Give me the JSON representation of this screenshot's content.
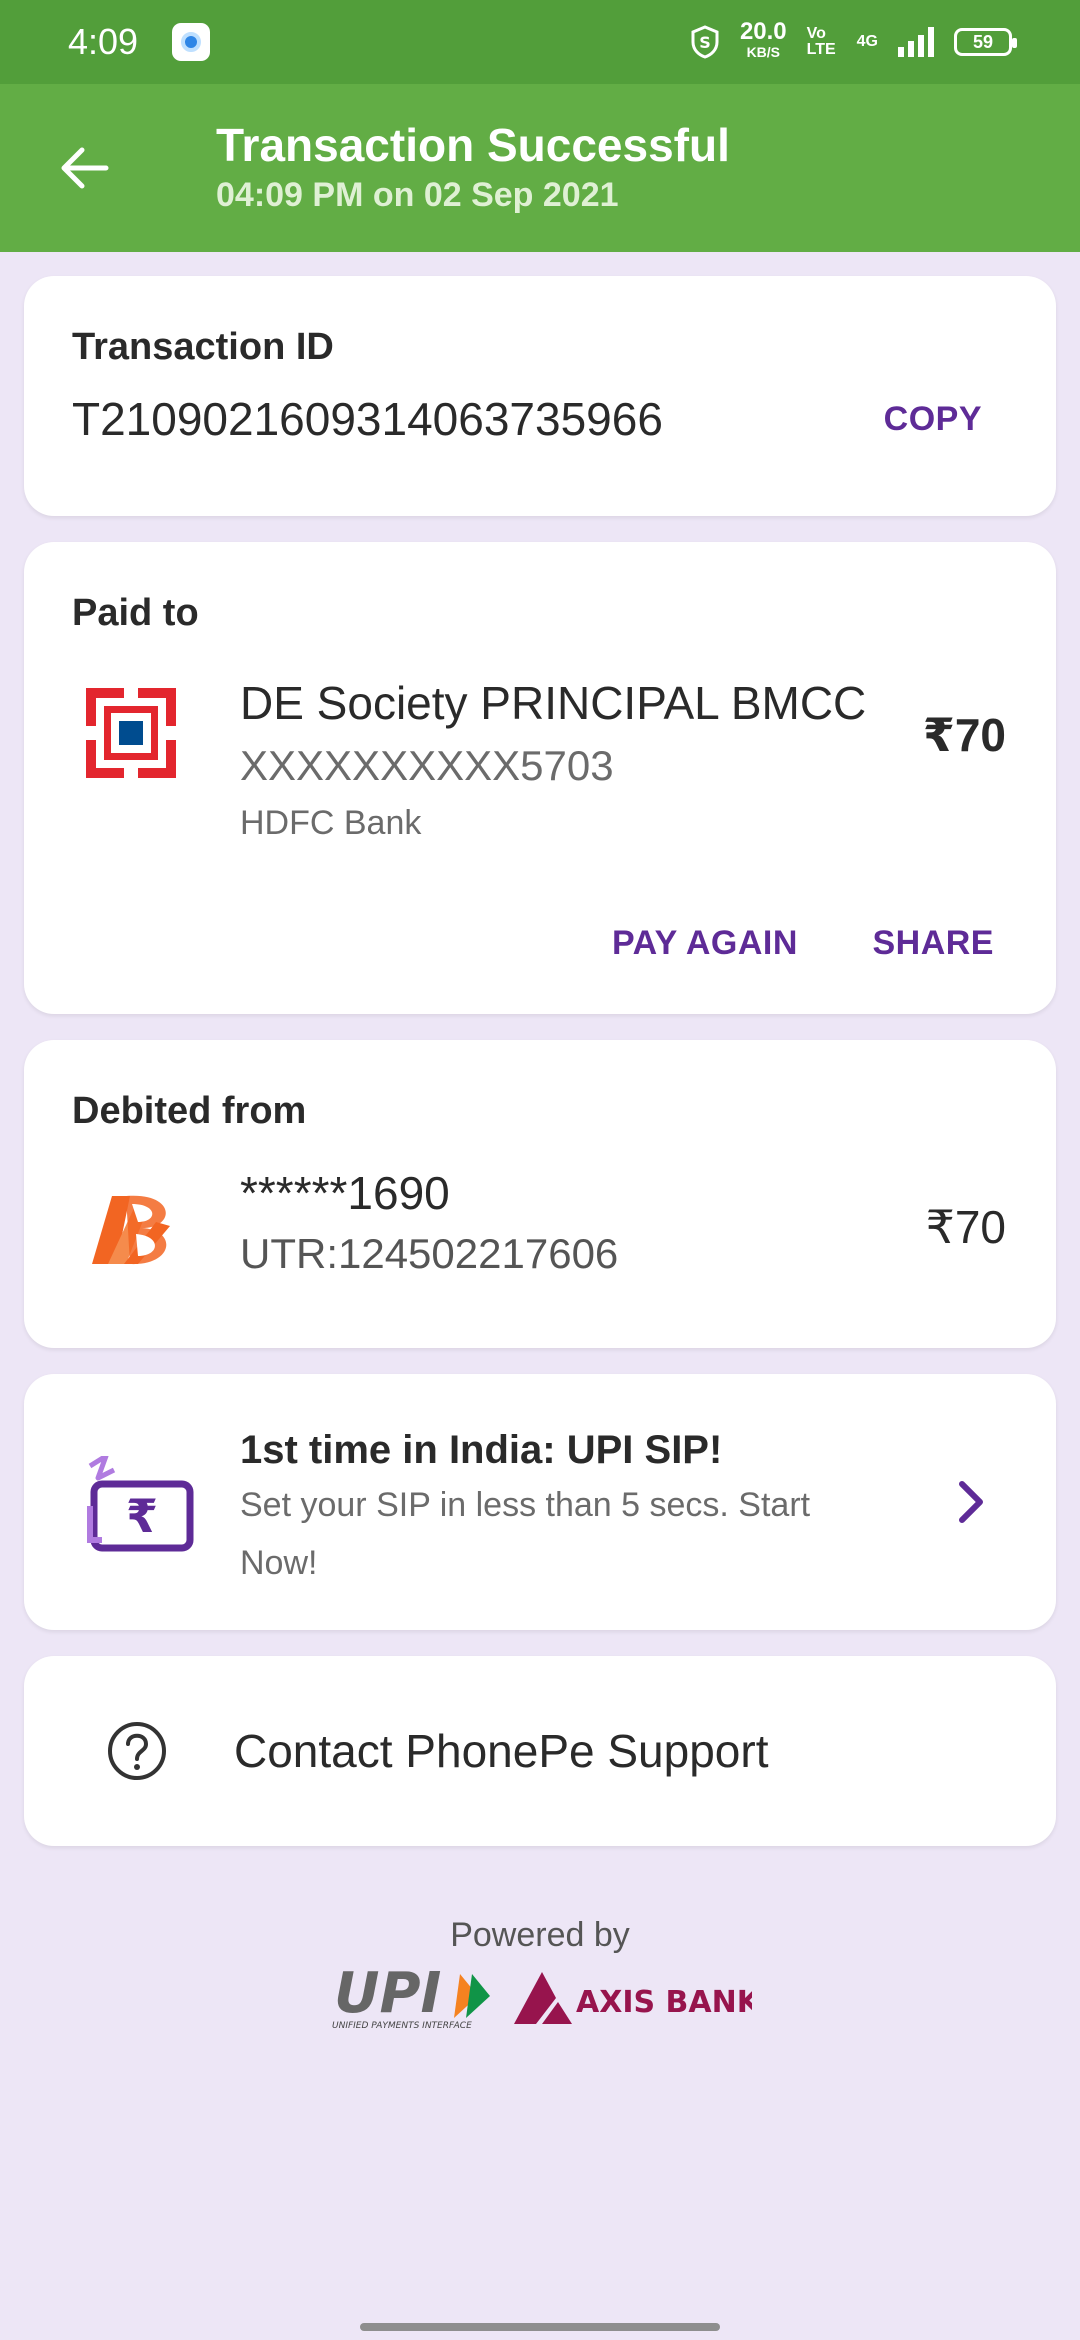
{
  "status_bar": {
    "time": "4:09",
    "speed": "20.0",
    "speed_unit": "KB/S",
    "volte": "Vo LTE",
    "network": "4G",
    "battery": "59"
  },
  "header": {
    "title": "Transaction Successful",
    "subtitle": "04:09 PM on 02 Sep 2021"
  },
  "transaction": {
    "label": "Transaction ID",
    "id": "T2109021609314063735966",
    "copy_label": "COPY"
  },
  "paid_to": {
    "label": "Paid to",
    "name": "DE Society PRINCIPAL BMCC",
    "account": "XXXXXXXXXX5703",
    "bank": "HDFC Bank",
    "amount": "₹70",
    "pay_again_label": "PAY AGAIN",
    "share_label": "SHARE"
  },
  "debited_from": {
    "label": "Debited from",
    "account": "******1690",
    "utr": "UTR:124502217606",
    "amount": "₹70"
  },
  "promo": {
    "title": "1st time in India: UPI SIP!",
    "line1": "Set your SIP in less than 5 secs. Start",
    "line2": "Now!"
  },
  "support": {
    "label": "Contact PhonePe Support"
  },
  "footer": {
    "powered_by": "Powered by",
    "upi_text": "UPI",
    "upi_sub": "UNIFIED PAYMENTS INTERFACE",
    "axis_text": "AXIS BANK"
  },
  "colors": {
    "status_bar": "#529e3a",
    "app_bar": "#62ad45",
    "accent": "#5e2b97",
    "background": "#ede6f6"
  }
}
